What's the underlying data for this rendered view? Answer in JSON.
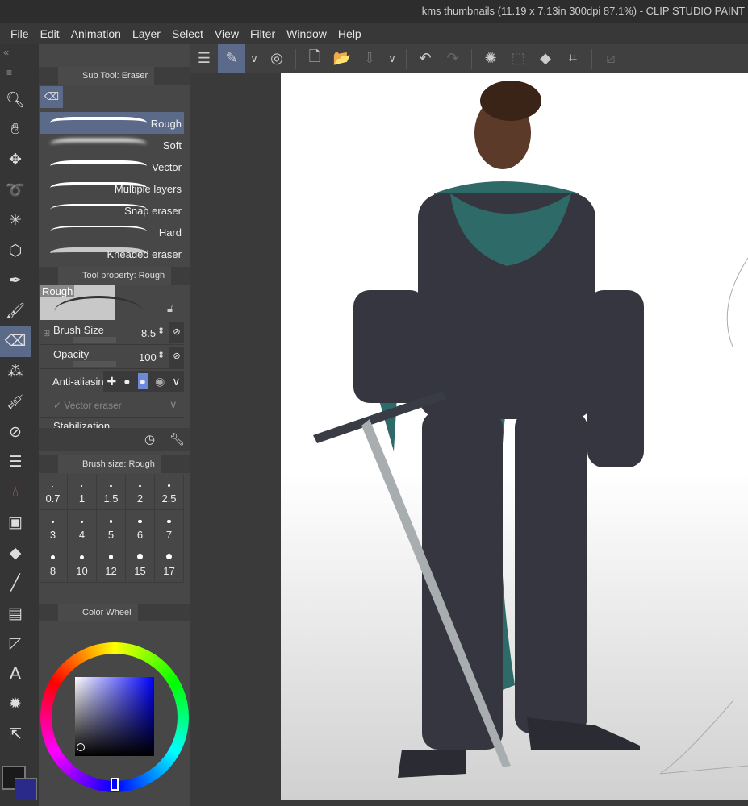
{
  "window": {
    "title": "kms thumbnails (11.19 x 7.13in 300dpi 87.1%)  - CLIP STUDIO PAINT"
  },
  "menu": [
    "File",
    "Edit",
    "Animation",
    "Layer",
    "Select",
    "View",
    "Filter",
    "Window",
    "Help"
  ],
  "sub_tool": {
    "title": "Sub Tool: Eraser",
    "items": [
      "Rough",
      "Soft",
      "Vector",
      "Multiple layers",
      "Snap eraser",
      "Hard",
      "Kneaded eraser"
    ],
    "selected": "Rough"
  },
  "tool_property": {
    "title": "Tool property: Rough",
    "preview_label": "Rough",
    "brush_size_label": "Brush Size",
    "brush_size": "8.5",
    "opacity_label": "Opacity",
    "opacity": "100",
    "anti_aliasing_label": "Anti-aliasing",
    "vector_eraser_label": "Vector eraser",
    "stabilization_label": "Stabilization"
  },
  "brush_size_panel": {
    "title": "Brush size: Rough",
    "sizes": [
      "0.7",
      "1",
      "1.5",
      "2",
      "2.5",
      "3",
      "4",
      "5",
      "6",
      "7",
      "8",
      "10",
      "12",
      "15",
      "17"
    ]
  },
  "color_wheel": {
    "title": "Color Wheel",
    "main_color": "#1a1a1a",
    "sub_color": "#2a2a8a"
  },
  "accent": "#5a6a88"
}
